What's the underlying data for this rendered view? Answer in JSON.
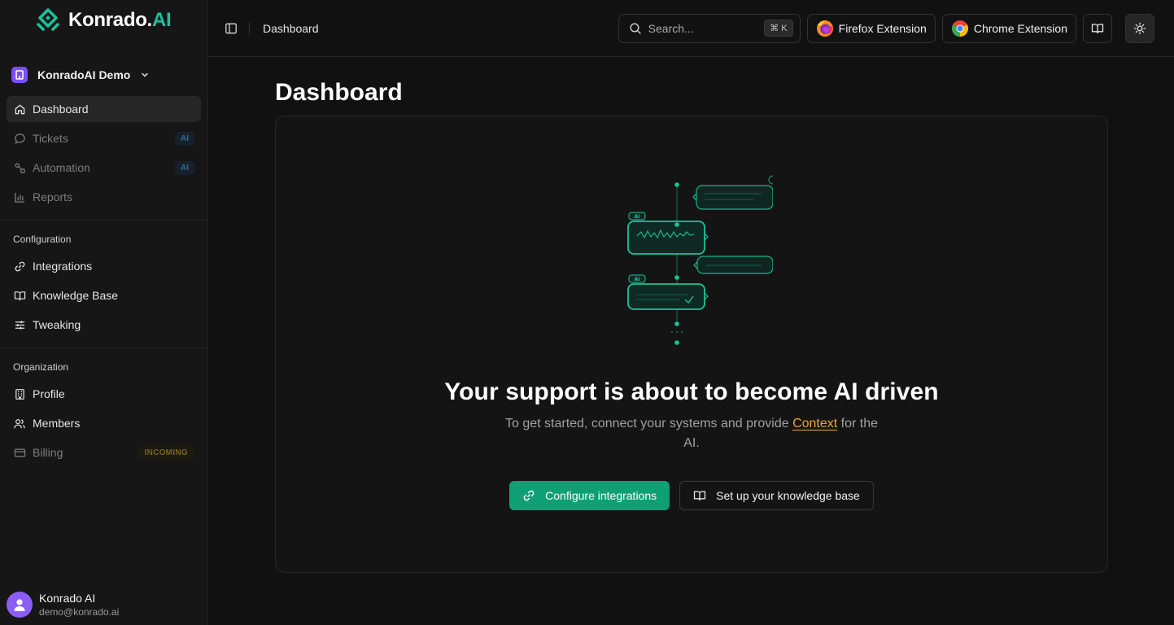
{
  "brand": {
    "name_main": "Konrado.",
    "name_accent": "AI",
    "accent_color": "#19c39a"
  },
  "org": {
    "name": "KonradoAI Demo"
  },
  "nav": {
    "main": [
      {
        "label": "Dashboard",
        "icon": "home-icon",
        "active": true
      },
      {
        "label": "Tickets",
        "icon": "chat-bubble-icon",
        "badge": "AI"
      },
      {
        "label": "Automation",
        "icon": "workflow-icon",
        "badge": "AI"
      },
      {
        "label": "Reports",
        "icon": "bar-chart-icon"
      }
    ],
    "configuration_title": "Configuration",
    "configuration": [
      {
        "label": "Integrations",
        "icon": "link-icon"
      },
      {
        "label": "Knowledge Base",
        "icon": "book-icon"
      },
      {
        "label": "Tweaking",
        "icon": "sliders-icon"
      }
    ],
    "organization_title": "Organization",
    "organization": [
      {
        "label": "Profile",
        "icon": "building-icon"
      },
      {
        "label": "Members",
        "icon": "users-icon"
      },
      {
        "label": "Billing",
        "icon": "credit-card-icon",
        "badge": "INCOMING"
      }
    ]
  },
  "user": {
    "name": "Konrado AI",
    "email": "demo@konrado.ai"
  },
  "topbar": {
    "breadcrumb": "Dashboard",
    "search_placeholder": "Search...",
    "search_shortcut": "⌘ K",
    "firefox_label": "Firefox Extension",
    "chrome_label": "Chrome Extension"
  },
  "page": {
    "title": "Dashboard",
    "headline": "Your support is about to become AI driven",
    "sub_before": "To get started, connect your systems and provide ",
    "sub_link": "Context",
    "sub_after": " for the AI.",
    "primary_button": "Configure integrations",
    "secondary_button": "Set up your knowledge base",
    "illustration_tags": [
      "AI",
      "AI"
    ]
  },
  "colors": {
    "primary": "#0f9f74",
    "link": "#e6a83c",
    "org_icon": "#7c4dff"
  }
}
